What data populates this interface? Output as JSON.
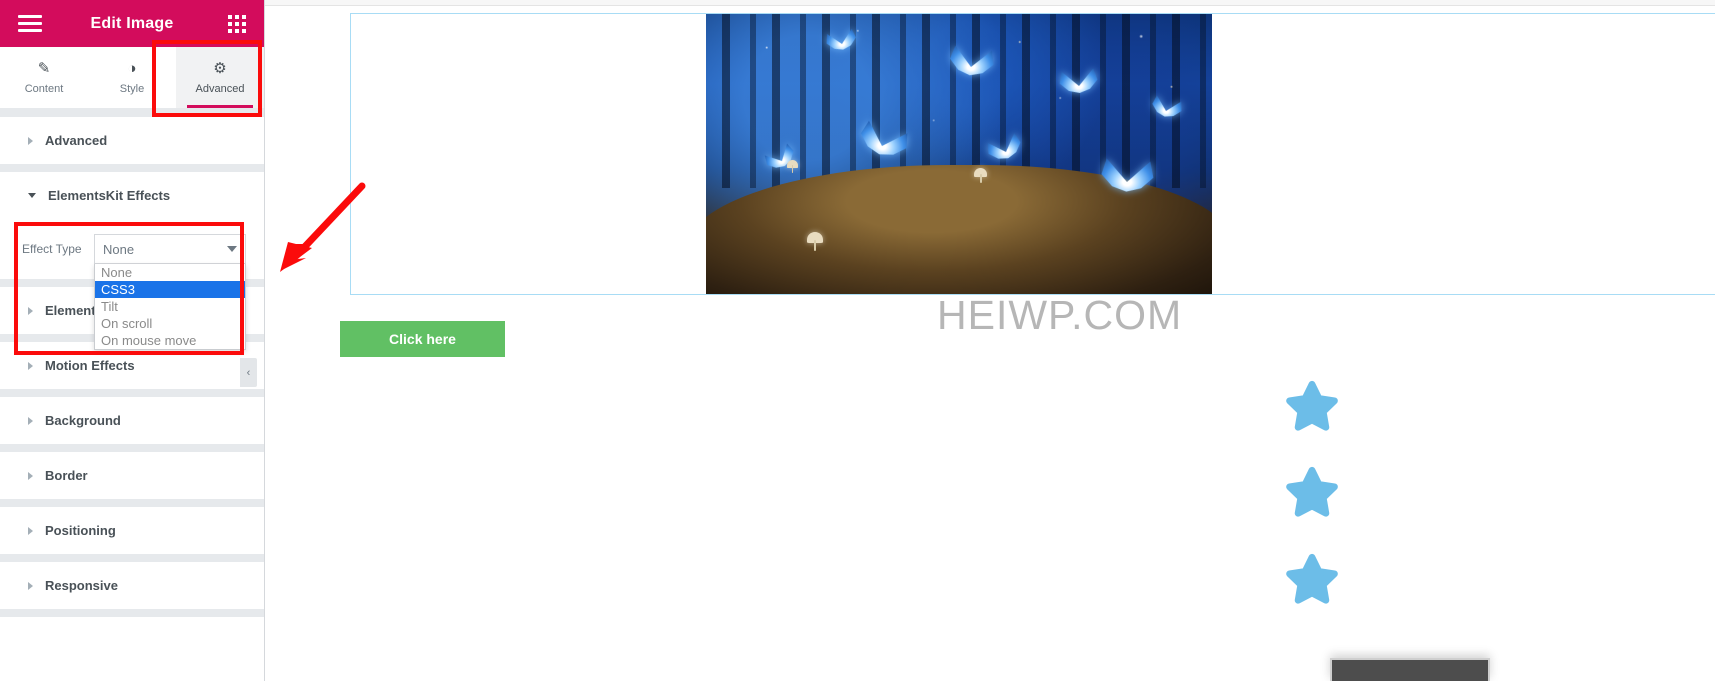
{
  "panel": {
    "header": {
      "title": "Edit Image",
      "menu_icon": "hamburger-icon",
      "apps_icon": "grid-apps-icon"
    },
    "tabs": [
      {
        "label": "Content",
        "icon": "pencil-icon",
        "glyph": "✎",
        "active": false
      },
      {
        "label": "Style",
        "icon": "contrast-icon",
        "glyph": "◑",
        "active": false
      },
      {
        "label": "Advanced",
        "icon": "gear-icon",
        "glyph": "⚙",
        "active": true
      }
    ],
    "sections": [
      {
        "label": "Advanced",
        "open": false
      },
      {
        "label": "ElementsKit Effects",
        "open": true
      },
      {
        "label": "Element",
        "open": false
      },
      {
        "label": "Motion Effects",
        "open": false
      },
      {
        "label": "Background",
        "open": false
      },
      {
        "label": "Border",
        "open": false
      },
      {
        "label": "Positioning",
        "open": false
      },
      {
        "label": "Responsive",
        "open": false
      }
    ],
    "effect_control": {
      "label": "Effect Type",
      "value": "None",
      "options": [
        {
          "label": "None",
          "selected": false
        },
        {
          "label": "CSS3",
          "selected": true
        },
        {
          "label": "Tilt",
          "selected": false
        },
        {
          "label": "On scroll",
          "selected": false
        },
        {
          "label": "On mouse move",
          "selected": false
        }
      ]
    },
    "collapse_handle": {
      "icon": "chevron-left-icon",
      "glyph": "‹"
    }
  },
  "canvas": {
    "image_widget": {
      "alt": "blue-butterflies-forest-photo"
    },
    "watermark": "HEIWP.COM",
    "button": {
      "label": "Click here"
    },
    "stars": [
      {
        "icon": "star-icon"
      },
      {
        "icon": "star-icon"
      },
      {
        "icon": "star-icon"
      }
    ]
  },
  "colors": {
    "brand_pink": "#d30c5c",
    "annotation_red": "#fb0b0b",
    "option_highlight": "#1a73e8",
    "button_green": "#61c064",
    "star_blue": "#6cbde8",
    "section_divider": "#e6e9ec",
    "widget_outline": "#a8dcf5"
  }
}
